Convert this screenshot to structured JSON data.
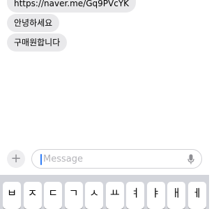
{
  "messages": [
    {
      "text": "https://naver.me/Gq9PVcYK"
    },
    {
      "text": "안녕하세요"
    },
    {
      "text": "구매원합니다"
    }
  ],
  "composer": {
    "placeholder": "Message",
    "plus_label": "+",
    "mic_icon": "microphone-icon"
  },
  "keyboard": {
    "top_row": [
      "ㅂ",
      "ㅈ",
      "ㄷ",
      "ㄱ",
      "ㅅ",
      "ㅛ",
      "ㅕ",
      "ㅑ",
      "ㅐ",
      "ㅔ"
    ]
  },
  "colors": {
    "incoming_bubble": "#e9e9eb",
    "caret": "#2f7cf6",
    "keyboard_bg": "#d3d5db"
  }
}
